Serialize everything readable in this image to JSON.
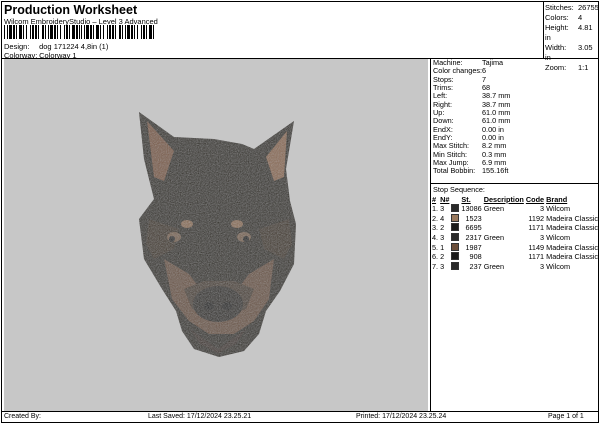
{
  "header": {
    "title": "Production Worksheet",
    "subtitle": "Wilcom EmbroideryStudio – Level 3 Advanced",
    "design_label": "Design:",
    "design_value": "dog 171224 4,8in (1)",
    "colorway_label": "Colorway:",
    "colorway_value": "Colorway 1"
  },
  "summary": [
    {
      "label": "Stitches:",
      "value": "26755"
    },
    {
      "label": "Colors:",
      "value": "4"
    },
    {
      "label": "Height:",
      "value": "4.81 in"
    },
    {
      "label": "Width:",
      "value": "3.05 in"
    },
    {
      "label": "Zoom:",
      "value": "1:1"
    }
  ],
  "specs": [
    {
      "label": "Machine:",
      "value": "Tajima"
    },
    {
      "label": "Color changes:",
      "value": "6"
    },
    {
      "label": "Stops:",
      "value": "7"
    },
    {
      "label": "Trims:",
      "value": "68"
    },
    {
      "label": "Left:",
      "value": "38.7 mm"
    },
    {
      "label": "Right:",
      "value": "38.7 mm"
    },
    {
      "label": "Up:",
      "value": "61.0 mm"
    },
    {
      "label": "Down:",
      "value": "61.0 mm"
    },
    {
      "label": "EndX:",
      "value": "0.00 in"
    },
    {
      "label": "EndY:",
      "value": "0.00 in"
    },
    {
      "label": "Max Stitch:",
      "value": "8.2 mm"
    },
    {
      "label": "Min Stitch:",
      "value": "0.3 mm"
    },
    {
      "label": "Max Jump:",
      "value": "6.9 mm"
    },
    {
      "label": "Total Bobbin:",
      "value": "155.16ft"
    }
  ],
  "stop_sequence": {
    "title": "Stop Sequence:",
    "headers": [
      "#",
      "N#",
      "St.",
      "Description",
      "Code",
      "Brand"
    ],
    "rows": [
      {
        "idx": "1.",
        "n": "3",
        "color": "#2a2a2a",
        "st": "13086",
        "desc": "Green",
        "code": "3",
        "brand": "Wilcom"
      },
      {
        "idx": "2.",
        "n": "4",
        "color": "#9a7a5e",
        "st": "1523",
        "desc": "",
        "code": "1192",
        "brand": "Madeira Classic 40"
      },
      {
        "idx": "3.",
        "n": "2",
        "color": "#1a1a1a",
        "st": "6695",
        "desc": "",
        "code": "1171",
        "brand": "Madeira Classic 40"
      },
      {
        "idx": "4.",
        "n": "3",
        "color": "#2a2a2a",
        "st": "2317",
        "desc": "Green",
        "code": "3",
        "brand": "Wilcom"
      },
      {
        "idx": "5.",
        "n": "1",
        "color": "#6b4e3a",
        "st": "1987",
        "desc": "",
        "code": "1149",
        "brand": "Madeira Classic 40"
      },
      {
        "idx": "6.",
        "n": "2",
        "color": "#1a1a1a",
        "st": "908",
        "desc": "",
        "code": "1171",
        "brand": "Madeira Classic 40"
      },
      {
        "idx": "7.",
        "n": "3",
        "color": "#2a2a2a",
        "st": "237",
        "desc": "Green",
        "code": "3",
        "brand": "Wilcom"
      }
    ]
  },
  "footer": {
    "created_by": "Created By:",
    "last_saved": "Last Saved: 17/12/2024 23.25.21",
    "printed": "Printed: 17/12/2024 23.25.24",
    "page": "Page 1 of 1"
  }
}
